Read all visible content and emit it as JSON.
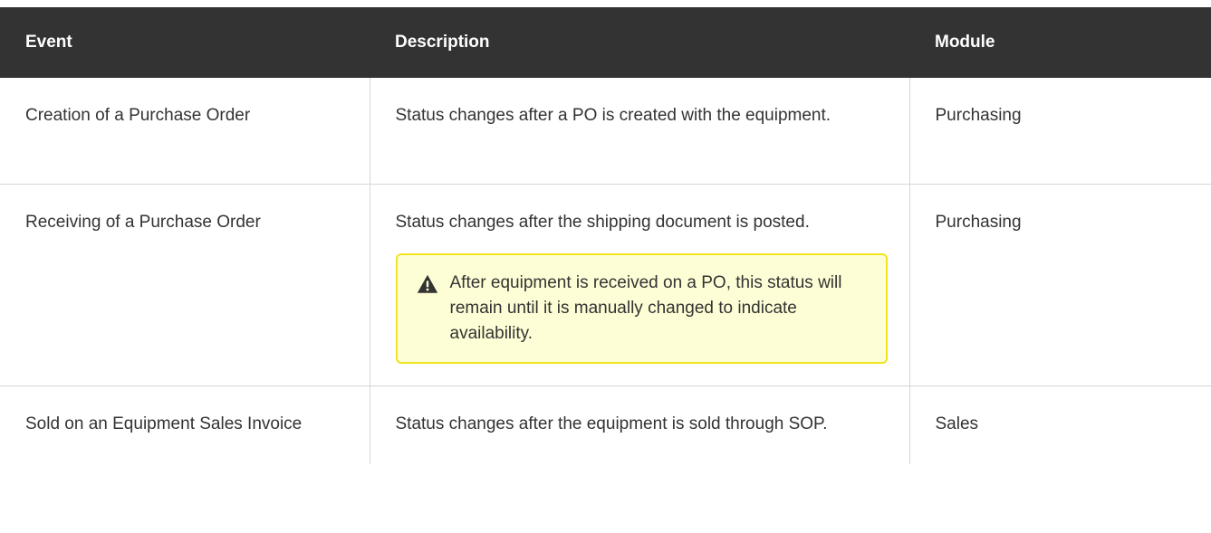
{
  "table": {
    "headers": {
      "event": "Event",
      "description": "Description",
      "module": "Module"
    },
    "rows": [
      {
        "event": "Creation of a Purchase Order",
        "description": "Status changes after a PO is created with the equipment.",
        "module": "Purchasing"
      },
      {
        "event": "Receiving of a Purchase Order",
        "description": "Status changes after the shipping document is posted.",
        "note": {
          "icon": "warning-icon",
          "text": "After equipment is received on a PO, this status will remain until it is manually changed to indicate availability."
        },
        "module": "Purchasing"
      },
      {
        "event": "Sold on an Equipment Sales Invoice",
        "description": "Status changes after the equipment is sold through SOP.",
        "module": "Sales"
      }
    ]
  },
  "colors": {
    "header_background": "#333333",
    "header_text": "#ffffff",
    "note_background": "#fefed6",
    "note_border": "#f0e51e",
    "grid_lines": "#d6d6d6"
  }
}
